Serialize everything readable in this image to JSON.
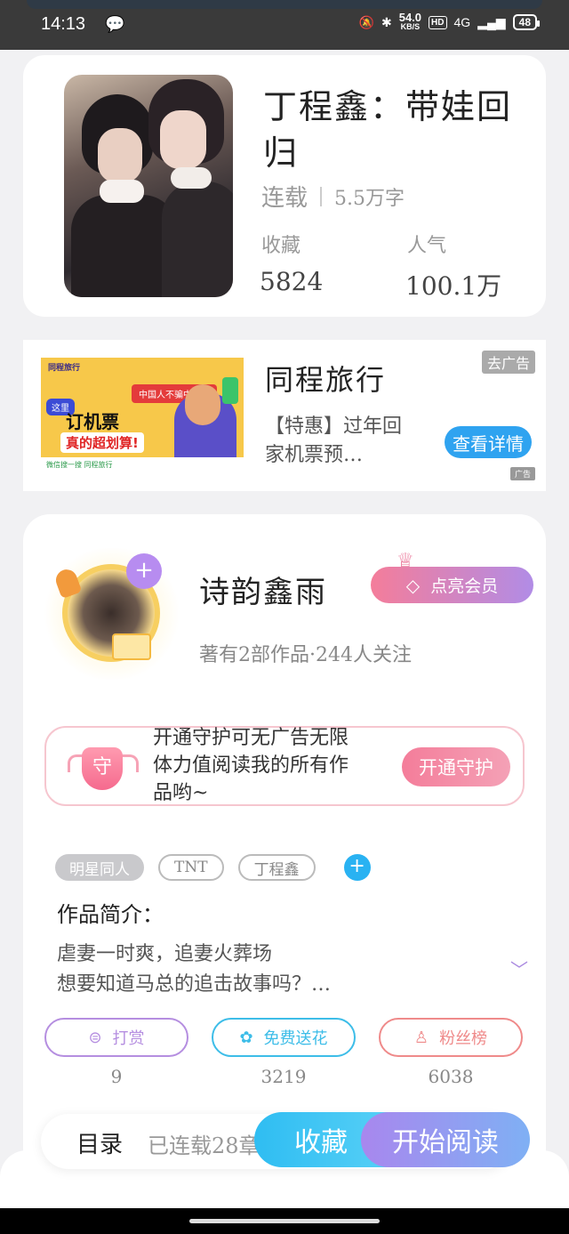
{
  "status_bar": {
    "time": "14:13",
    "speed_value": "54.0",
    "speed_unit": "KB/S",
    "hd": "HD",
    "network": "4G",
    "battery": "48"
  },
  "book": {
    "title": "丁程鑫：带娃回归",
    "status": "连载",
    "word_count": "5.5万字",
    "favorites_label": "收藏",
    "favorites_value": "5824",
    "popularity_label": "人气",
    "popularity_value": "100.1万"
  },
  "ad": {
    "image_texts": {
      "brand": "同程旅行",
      "banner": "中国人不骗中国人",
      "bubble": "这里",
      "headline": "订机票",
      "subheadline": "真的超划算!",
      "strip": "微信搜一搜 同程旅行"
    },
    "title": "同程旅行",
    "description": "【特惠】过年回家机票预…",
    "close_label": "去广告",
    "detail_button": "查看详情",
    "badge": "广告"
  },
  "author": {
    "name": "诗韵鑫雨",
    "vip_button": "点亮会员",
    "meta": "著有2部作品·244人关注",
    "guard_text": "开通守护可无广告无限体力值阅读我的所有作品哟~",
    "guard_shield": "守",
    "guard_button": "开通守护"
  },
  "tags": [
    "明星同人",
    "TNT",
    "丁程鑫"
  ],
  "intro": {
    "label": "作品简介：",
    "line1": "虐妻一时爽，追妻火葬场",
    "line2": "想要知道马总的追击故事吗？…"
  },
  "actions": [
    {
      "label": "打赏",
      "count": "9",
      "color": "#b58ee0"
    },
    {
      "label": "免费送花",
      "count": "3219",
      "color": "#3dbde8"
    },
    {
      "label": "粉丝榜",
      "count": "6038",
      "color": "#ef8a8a"
    }
  ],
  "bottom": {
    "catalog_label": "目录",
    "catalog_status": "已连载28章",
    "favorite_button": "收藏",
    "read_button": "开始阅读"
  }
}
